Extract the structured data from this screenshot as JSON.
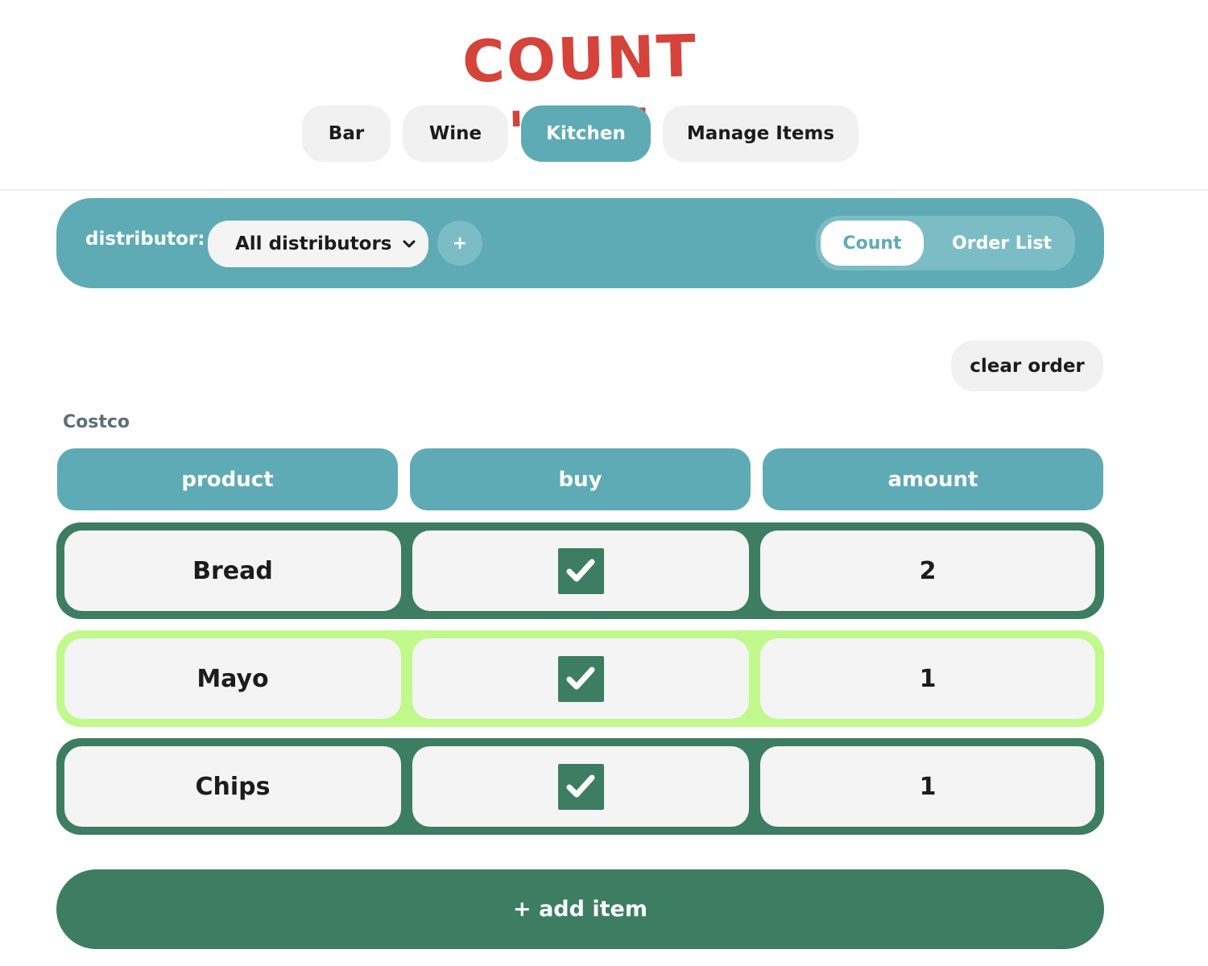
{
  "app": {
    "title": "COUNT 'EM!"
  },
  "nav": {
    "tabs": [
      {
        "label": "Bar"
      },
      {
        "label": "Wine"
      },
      {
        "label": "Kitchen",
        "active": true
      },
      {
        "label": "Manage Items"
      }
    ]
  },
  "toolbar": {
    "distributor_label": "distributor:",
    "distributor_selected": "All distributors",
    "add_distributor_label": "+",
    "view_toggle": {
      "count_label": "Count",
      "order_list_label": "Order List",
      "active": "Count"
    }
  },
  "actions": {
    "clear_order_label": "clear order",
    "add_item_label": "+ add item"
  },
  "group": {
    "name": "Costco",
    "columns": [
      "product",
      "buy",
      "amount"
    ],
    "rows": [
      {
        "product": "Bread",
        "buy": true,
        "amount": "2"
      },
      {
        "product": "Mayo",
        "buy": true,
        "amount": "1"
      },
      {
        "product": "Chips",
        "buy": true,
        "amount": "1"
      }
    ]
  },
  "colors": {
    "accent": "#5eabb5",
    "dark_green": "#3d7d62",
    "highlight": "#c1f98c",
    "logo_red": "#d5433a"
  },
  "icons": {
    "checkbox_checked": "check-icon",
    "select_caret": "chevron-down-icon"
  }
}
